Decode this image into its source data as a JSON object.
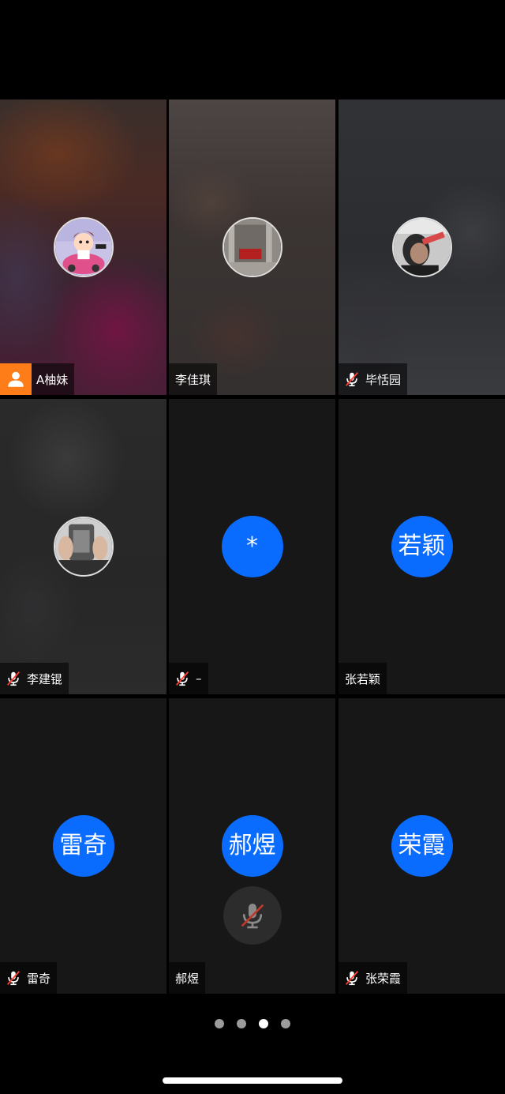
{
  "participants": [
    {
      "name": "A柚妹",
      "host": true,
      "muted": false,
      "avatar": "cartoon-avatar"
    },
    {
      "name": "李佳琪",
      "host": false,
      "muted": false,
      "avatar": "photo-avatar-room"
    },
    {
      "name": "毕恬园",
      "host": false,
      "muted": true,
      "avatar": "photo-avatar-person"
    },
    {
      "name": "李建锟",
      "host": false,
      "muted": true,
      "avatar": "photo-avatar-hands"
    },
    {
      "name": "–",
      "initials": "*",
      "host": false,
      "muted": true
    },
    {
      "name": "张若颖",
      "initials": "若颖",
      "host": false,
      "muted": false
    },
    {
      "name": "雷奇",
      "initials": "雷奇",
      "host": false,
      "muted": true
    },
    {
      "name": "郝煜",
      "initials": "郝煜",
      "host": false,
      "muted": false
    },
    {
      "name": "张荣霞",
      "initials": "荣霞",
      "host": false,
      "muted": true
    }
  ],
  "pagination": {
    "pages": 4,
    "current": 3
  },
  "colors": {
    "avatar_blue": "#0a6cff",
    "host_badge": "#ff7d18",
    "mute_slash": "#ff3b30"
  },
  "icons": {
    "host": "person-icon",
    "muted": "mic-off-icon"
  }
}
